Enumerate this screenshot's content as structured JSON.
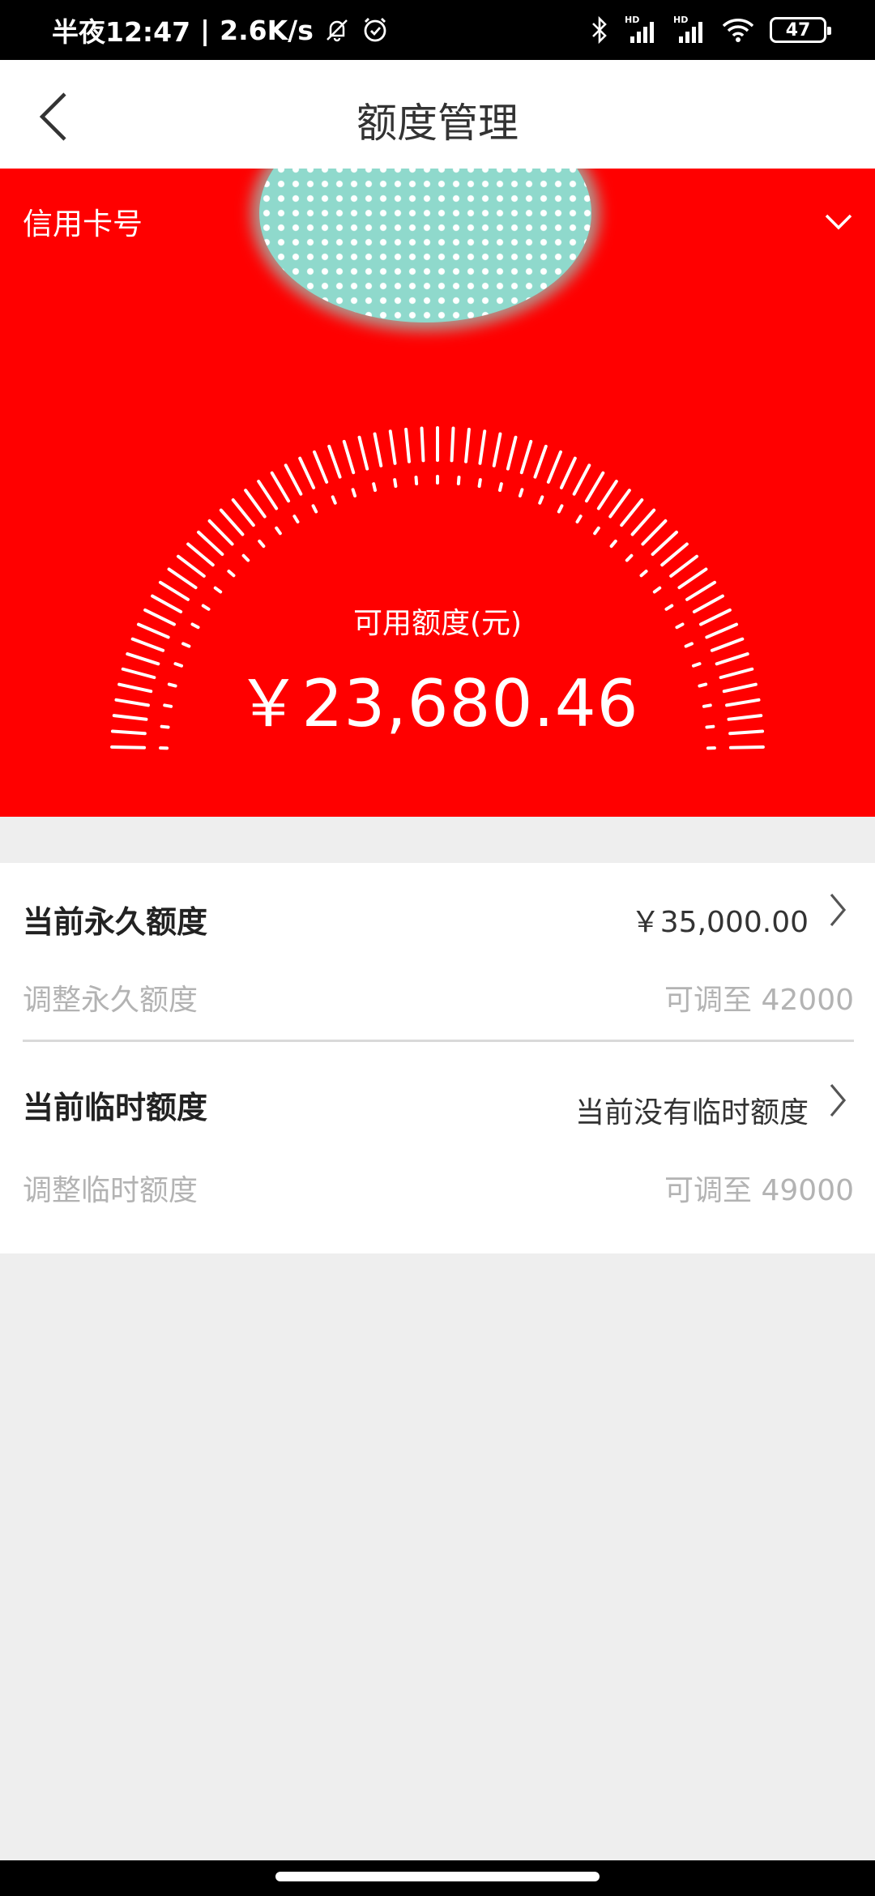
{
  "status_bar": {
    "time": "半夜12:47",
    "network_speed": "2.6K/s",
    "battery": "47",
    "icons": [
      "mute-bell-icon",
      "alarm-icon",
      "bluetooth-icon",
      "hd-signal-icon",
      "hd-signal-icon",
      "wifi-icon",
      "battery-icon"
    ]
  },
  "nav": {
    "title": "额度管理",
    "back_icon": "chevron-left-icon"
  },
  "header": {
    "card_label": "信用卡号",
    "toggle_icon": "chevron-down-icon",
    "available_label": "可用额度(元)",
    "available_amount": "￥23,680.46",
    "background_color": "#ff0000"
  },
  "limits": {
    "permanent": {
      "title": "当前永久额度",
      "value": "￥35,000.00",
      "adjust_label": "调整永久额度",
      "adjust_value": "可调至 42000"
    },
    "temporary": {
      "title": "当前临时额度",
      "value": "当前没有临时额度",
      "adjust_label": "调整临时额度",
      "adjust_value": "可调至 49000"
    }
  }
}
